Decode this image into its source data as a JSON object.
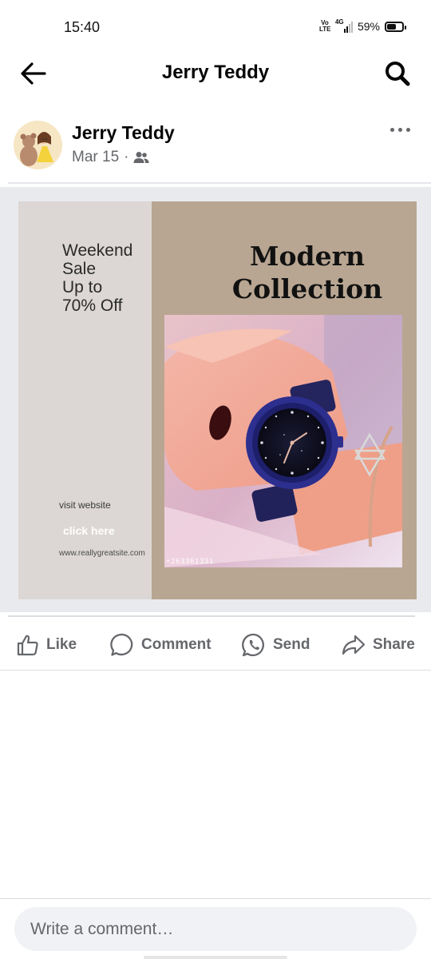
{
  "status_bar": {
    "time": "15:40",
    "volte": "Vo LTE",
    "network": "4G",
    "battery": "59%"
  },
  "header": {
    "title": "Jerry Teddy",
    "back_icon": "arrow-left-icon",
    "search_icon": "search-icon"
  },
  "post": {
    "author": "Jerry Teddy",
    "date": "Mar 15",
    "separator": "·",
    "audience_icon": "friends-icon",
    "more_icon": "more-horizontal-icon",
    "image": {
      "sale_text": "Weekend\nSale\nUp to\n70% Off",
      "title": "Modern\nCollection",
      "visit_text": "visit website",
      "click_text": "click here",
      "url": "www.reallygreatsite.com",
      "phone": "+263361331"
    }
  },
  "actions": [
    {
      "label": "Like",
      "icon": "thumbs-up-icon"
    },
    {
      "label": "Comment",
      "icon": "comment-icon"
    },
    {
      "label": "Send",
      "icon": "whatsapp-icon"
    },
    {
      "label": "Share",
      "icon": "share-icon"
    }
  ],
  "comment_bar": {
    "placeholder": "Write a comment…"
  },
  "colors": {
    "text_primary": "#050505",
    "text_secondary": "#65676b",
    "divider": "#dadde1",
    "input_background": "#f0f2f5",
    "ad_left_panel": "#dcd7d4",
    "ad_right_panel": "#b8a692"
  }
}
